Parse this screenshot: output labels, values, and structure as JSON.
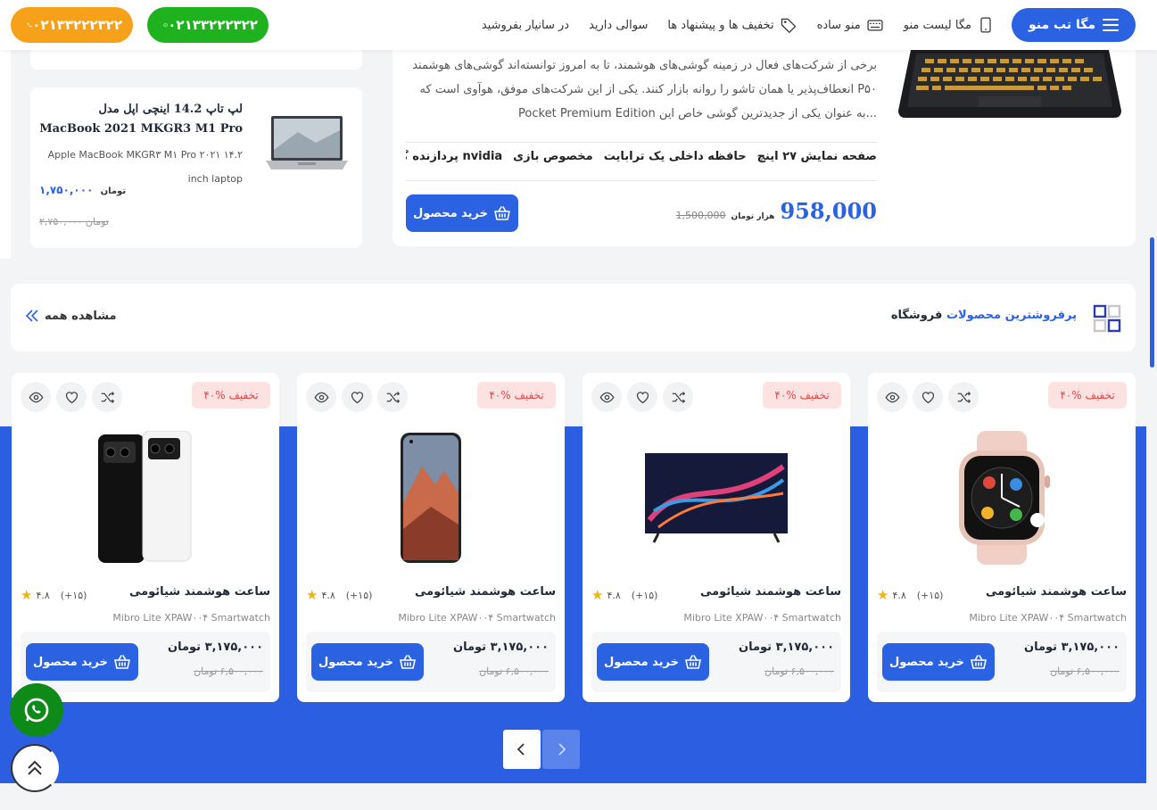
{
  "header": {
    "phone_orange": "۰۲۱۳۳۲۲۲۳۲۲",
    "phone_green": "۰۲۱۳۳۲۲۲۳۲۲",
    "menu_button": "مگا تب منو",
    "nav": [
      {
        "label": "مگا لیست منو",
        "icon": "mobile-icon"
      },
      {
        "label": "منو ساده",
        "icon": "keyboard-icon"
      },
      {
        "label": "تخفیف ها و پیشنهاد ها",
        "icon": "tag-icon"
      },
      {
        "label": "سوالی دارید",
        "icon": ""
      },
      {
        "label": "در سانیار بفروشید",
        "icon": ""
      }
    ]
  },
  "side_card": {
    "title": "لپ تاپ 14.2 اینچی اپل مدل MacBook 2021 MKGR3 M1 Pro",
    "subtitle": "Apple MacBook MKGR۳ M۱ Pro ۲۰۲۱ ۱۴.۲ inch laptop",
    "price": "۱,۷۵۰,۰۰۰",
    "currency": "تومان",
    "old_price": "۲,۷۵۰,۰۰۰ تومان"
  },
  "feature": {
    "description": "برخی از شرکت‌های فعال در زمینه گوشی‌های هوشمند، تا به امروز توانسته‌اند گوشی‌های هوشمند انعطاف‌پذیر یا همان تاشو را روانه بازار کنند. یکی از این شرکت‌های موفق، هوآوی است که P۵۰ Pocket Premium Edition به عنوان یکی از جدیدترین گوشی خاص این...",
    "specs": [
      "صفحه نمایش ۲۷ اینچ",
      "حافظه داخلی یک ترابایت",
      "مخصوص بازی",
      "پردازنده گرافیکی nvidia"
    ],
    "price": "958,000",
    "price_unit": "هزار تومان",
    "old_price": "1,500,000",
    "buy_label": "خرید محصول"
  },
  "section": {
    "title_highlight": "پرفروشترین محصولات",
    "title_rest": "فروشگاه",
    "see_all": "مشاهده همه"
  },
  "products": [
    {
      "discount": "۴۰% تخفیف",
      "name": "ساعت هوشمند شیائومی",
      "en": "Mibro Lite XPAW۰۰۴ Smartwatch",
      "rating": "۴.۸",
      "reviews": "(+۱۵)",
      "price": "۳,۱۷۵,۰۰۰ تومان",
      "old_price": "۶,۵۰۰,۰۰۰ تومان",
      "buy": "خرید محصول",
      "image": "smartwatch"
    },
    {
      "discount": "۴۰% تخفیف",
      "name": "ساعت هوشمند شیائومی",
      "en": "Mibro Lite XPAW۰۰۴ Smartwatch",
      "rating": "۴.۸",
      "reviews": "(+۱۵)",
      "price": "۳,۱۷۵,۰۰۰ تومان",
      "old_price": "۶,۵۰۰,۰۰۰ تومان",
      "buy": "خرید محصول",
      "image": "tv"
    },
    {
      "discount": "۴۰% تخفیف",
      "name": "ساعت هوشمند شیائومی",
      "en": "Mibro Lite XPAW۰۰۴ Smartwatch",
      "rating": "۴.۸",
      "reviews": "(+۱۵)",
      "price": "۳,۱۷۵,۰۰۰ تومان",
      "old_price": "۶,۵۰۰,۰۰۰ تومان",
      "buy": "خرید محصول",
      "image": "phone"
    },
    {
      "discount": "۴۰% تخفیف",
      "name": "ساعت هوشمند شیائومی",
      "en": "Mibro Lite XPAW۰۰۴ Smartwatch",
      "rating": "۴.۸",
      "reviews": "(+۱۵)",
      "price": "۳,۱۷۵,۰۰۰ تومان",
      "old_price": "۶,۵۰۰,۰۰۰ تومان",
      "buy": "خرید محصول",
      "image": "phones-pair"
    }
  ],
  "colors": {
    "primary": "#2b62e2",
    "whatsapp": "#1fb21f",
    "orange": "#f7a11a",
    "discount": "#e24848"
  }
}
